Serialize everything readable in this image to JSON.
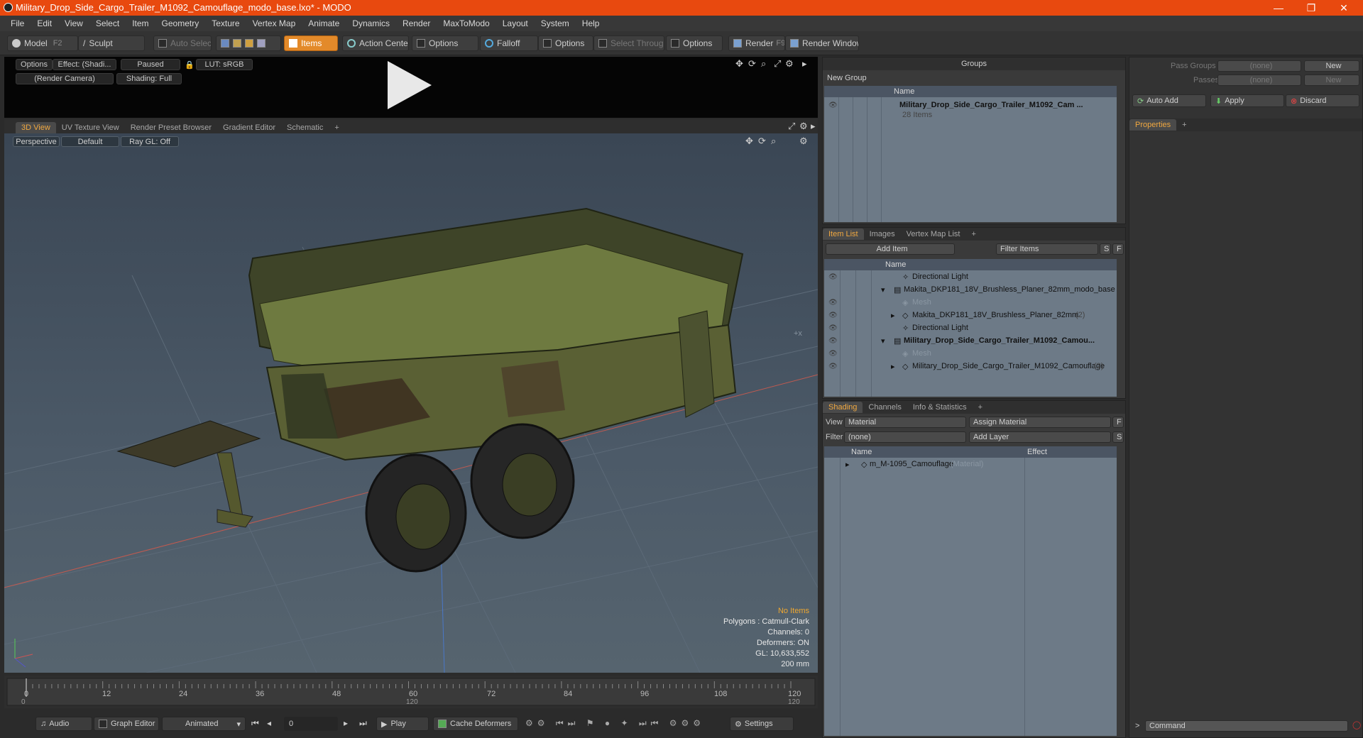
{
  "window": {
    "title": "Military_Drop_Side_Cargo_Trailer_M1092_Camouflage_modo_base.lxo* - MODO"
  },
  "menu": [
    "File",
    "Edit",
    "View",
    "Select",
    "Item",
    "Geometry",
    "Texture",
    "Vertex Map",
    "Animate",
    "Dynamics",
    "Render",
    "MaxToModo",
    "Layout",
    "System",
    "Help"
  ],
  "toolbar": {
    "model": "Model",
    "model_key": "F2",
    "sculpt": "Sculpt",
    "auto_select": "Auto Select",
    "items": "Items",
    "action_center": "Action Center",
    "options1": "Options",
    "falloff": "Falloff",
    "options2": "Options",
    "select_through": "Select Through",
    "options3": "Options",
    "render": "Render",
    "render_key": "F9",
    "render_window": "Render Window"
  },
  "preview": {
    "options": "Options",
    "effect": "Effect: (Shadi...",
    "paused": "Paused",
    "lut": "LUT: sRGB",
    "camera": "(Render Camera)",
    "shading": "Shading: Full"
  },
  "viewport_tabs": [
    "3D View",
    "UV Texture View",
    "Render Preset Browser",
    "Gradient Editor",
    "Schematic"
  ],
  "viewport": {
    "perspective": "Perspective",
    "style": "Default",
    "raygl": "Ray GL: Off",
    "crosshair": "+x"
  },
  "info": {
    "no_items": "No Items",
    "polygons": "Polygons : Catmull-Clark",
    "channels": "Channels: 0",
    "deformers": "Deformers: ON",
    "gl": "GL: 10,633,552",
    "scale": "200 mm"
  },
  "timeline": {
    "ticks": [
      "0",
      "12",
      "24",
      "36",
      "48",
      "60",
      "72",
      "84",
      "96",
      "108",
      "120"
    ],
    "start": "0",
    "mid": "120",
    "end": "120"
  },
  "bottom": {
    "audio": "Audio",
    "graph_editor": "Graph Editor",
    "animated": "Animated",
    "frame": "0",
    "play": "Play",
    "cache": "Cache Deformers",
    "settings": "Settings"
  },
  "groups": {
    "title": "Groups",
    "new_group": "New Group",
    "col_name": "Name",
    "item_name": "Military_Drop_Side_Cargo_Trailer_M1092_Cam ...",
    "item_count": "28 Items"
  },
  "itemlist": {
    "tabs": [
      "Item List",
      "Images",
      "Vertex Map List"
    ],
    "add_item": "Add Item",
    "filter": "Filter Items",
    "s": "S",
    "f": "F",
    "col_name": "Name",
    "rows": [
      {
        "name": "Directional Light",
        "sub": ""
      },
      {
        "name": "Makita_DKP181_18V_Brushless_Planer_82mm_modo_base ...",
        "sub": ""
      },
      {
        "name": "Mesh",
        "sub": ""
      },
      {
        "name": "Makita_DKP181_18V_Brushless_Planer_82mm",
        "sub": "(2)"
      },
      {
        "name": "Directional Light",
        "sub": ""
      },
      {
        "name": "Military_Drop_Side_Cargo_Trailer_M1092_Camou...",
        "sub": ""
      },
      {
        "name": "Mesh",
        "sub": ""
      },
      {
        "name": "Military_Drop_Side_Cargo_Trailer_M1092_Camouflage",
        "sub": "(2)"
      }
    ]
  },
  "shading": {
    "tabs": [
      "Shading",
      "Channels",
      "Info & Statistics"
    ],
    "view_label": "View",
    "view_value": "Material",
    "assign": "Assign Material",
    "f": "F",
    "filter_label": "Filter",
    "filter_value": "(none)",
    "add_layer": "Add Layer",
    "s": "S",
    "col_name": "Name",
    "col_effect": "Effect",
    "material": "m_M-1095_Camouflage",
    "material_type": "(Material)"
  },
  "passes": {
    "pass_groups": "Pass Groups",
    "pass_groups_value": "(none)",
    "new": "New",
    "passes": "Passes",
    "passes_value": "(none)",
    "new2": "New",
    "auto_add": "Auto Add",
    "apply": "Apply",
    "discard": "Discard",
    "properties": "Properties",
    "command": "Command"
  },
  "colors": {
    "accent": "#e38a2a",
    "title": "#e8490f"
  }
}
